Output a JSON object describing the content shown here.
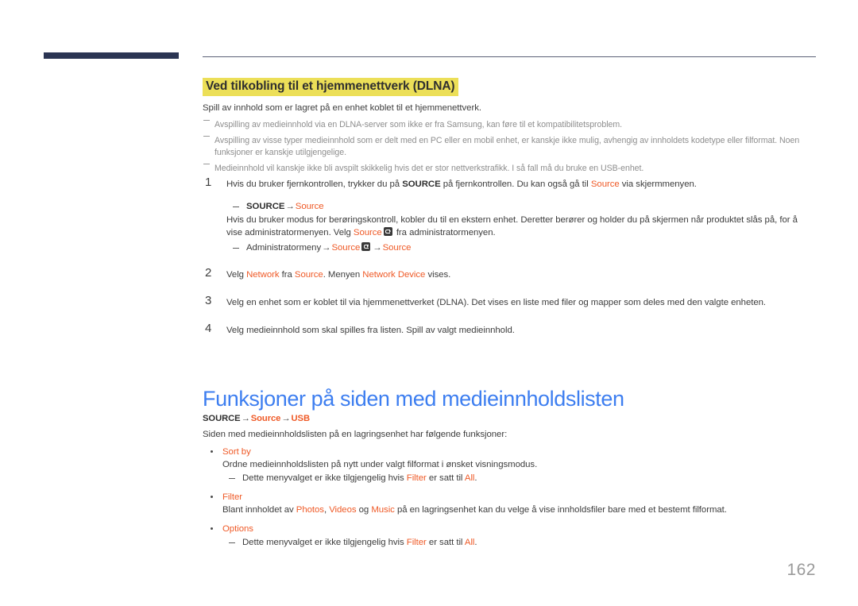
{
  "document": {
    "page_number": "162",
    "accent_color": "#ef5a27",
    "heading_color": "#3d7ef0",
    "highlight_color": "#ecdf58",
    "navy_color": "#2b3553"
  },
  "section": {
    "highlighted_heading": "Ved tilkobling til et hjemmenettverk (DLNA)",
    "intro": "Spill av innhold som er lagret på en enhet koblet til et hjemmenettverk.",
    "notes": [
      "Avspilling av medieinnhold via en DLNA-server som ikke er fra Samsung, kan føre til et kompatibilitetsproblem.",
      "Avspilling av visse typer medieinnhold som er delt med en PC eller en mobil enhet, er kanskje ikke mulig, avhengig av innholdets kodetype eller filformat. Noen funksjoner er kanskje utilgjengelige.",
      "Medieinnhold vil kanskje ikke bli avspilt skikkelig hvis det er stor nettverkstrafikk. I så fall må du bruke en USB-enhet."
    ]
  },
  "steps": [
    {
      "number": "1",
      "text_a": "Hvis du bruker fjernkontrollen, trykker du på ",
      "bold_a": "SOURCE",
      "text_b": " på fjernkontrollen. Du kan også gå til ",
      "accent_a": "Source",
      "text_c": " via skjermmenyen.",
      "sub1_bold": "SOURCE",
      "sub1_arrow": "→",
      "sub1_accent": "Source",
      "body_a": "Hvis du bruker modus for berøringskontroll, kobler du til en ekstern enhet. Deretter berører og holder du på skjermen når produktet slås på, for å vise administratormenyen. Velg ",
      "body_accent": "Source",
      "body_icon": "enter-key-icon",
      "body_b": " fra administratormenyen.",
      "sub2_text": "Administratormeny",
      "sub2_arrow1": "→",
      "sub2_accent1": "Source",
      "sub2_icon": "enter-key-icon",
      "sub2_arrow2": "→",
      "sub2_accent2": "Source"
    },
    {
      "number": "2",
      "text_a": "Velg ",
      "accent_a": "Network",
      "text_b": " fra ",
      "accent_b": "Source",
      "text_c": ". Menyen ",
      "accent_c": "Network Device",
      "text_d": " vises."
    },
    {
      "number": "3",
      "text_a": "Velg en enhet som er koblet til via hjemmenettverket (DLNA). Det vises en liste med filer og mapper som deles med den valgte enheten."
    },
    {
      "number": "4",
      "text_a": "Velg medieinnhold som skal spilles fra listen. Spill av valgt medieinnhold."
    }
  ],
  "main_section": {
    "heading": "Funksjoner på siden med medieinnholdslisten",
    "path": {
      "bold": "SOURCE",
      "arrow1": "→",
      "accent1": "Source",
      "arrow2": "→",
      "accent2": "USB"
    },
    "description": "Siden med medieinnholdslisten på en lagringsenhet har følgende funksjoner:",
    "features": [
      {
        "title": "Sort by",
        "desc": "Ordne medieinnholdslisten på nytt under valgt filformat i ønsket visningsmodus.",
        "note_a": "Dette menyvalget er ikke tilgjengelig hvis ",
        "note_accent_a": "Filter",
        "note_b": " er satt til ",
        "note_accent_b": "All",
        "note_c": "."
      },
      {
        "title": "Filter",
        "desc_a": "Blant innholdet av ",
        "desc_accent_a": "Photos",
        "desc_sep1": ", ",
        "desc_accent_b": "Videos",
        "desc_sep2": " og ",
        "desc_accent_c": "Music",
        "desc_b": " på en lagringsenhet kan du velge å vise innholdsfiler bare med et bestemt filformat."
      },
      {
        "title": "Options",
        "note_a": "Dette menyvalget er ikke tilgjengelig hvis ",
        "note_accent_a": "Filter",
        "note_b": " er satt til ",
        "note_accent_b": "All",
        "note_c": "."
      }
    ]
  }
}
